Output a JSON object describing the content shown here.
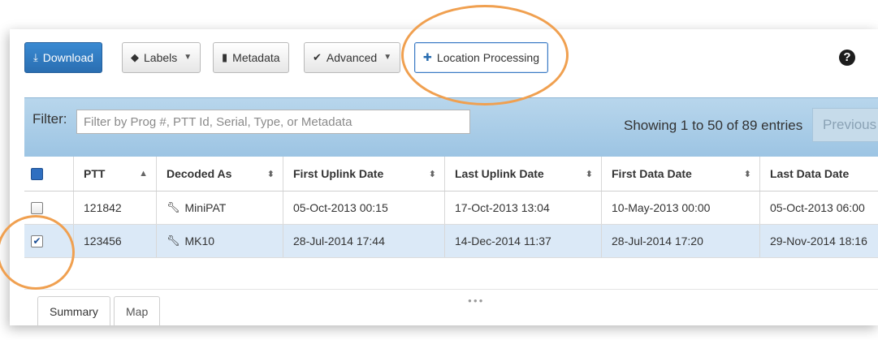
{
  "toolbar": {
    "download_label": "Download",
    "labels_label": "Labels",
    "metadata_label": "Metadata",
    "advanced_label": "Advanced",
    "location_processing_label": "Location Processing",
    "help_glyph": "?"
  },
  "filter": {
    "label": "Filter:",
    "placeholder": "Filter by Prog #, PTT Id, Serial, Type, or Metadata",
    "showing_text": "Showing 1 to 50 of 89 entries",
    "previous_label": "Previous"
  },
  "table": {
    "headers": [
      "PTT",
      "Decoded As",
      "First Uplink Date",
      "Last Uplink Date",
      "First Data Date",
      "Last Data Date"
    ],
    "rows": [
      {
        "checked": false,
        "ptt": "121842",
        "decoded_as": "MiniPAT",
        "first_uplink": "05-Oct-2013 00:15",
        "last_uplink": "17-Oct-2013 13:04",
        "first_data": "10-May-2013 00:00",
        "last_data": "05-Oct-2013 06:00"
      },
      {
        "checked": true,
        "ptt": "123456",
        "decoded_as": "MK10",
        "first_uplink": "28-Jul-2014 17:44",
        "last_uplink": "14-Dec-2014 11:37",
        "first_data": "28-Jul-2014 17:20",
        "last_data": "29-Nov-2014 18:16"
      }
    ]
  },
  "tabs": [
    "Summary",
    "Map"
  ],
  "icons": {
    "download": "download-icon",
    "labels": "tag-icon",
    "metadata": "book-icon",
    "advanced": "check-circle-icon",
    "location": "crosshair-icon",
    "help": "question-icon",
    "sort": "sort-icon",
    "wrench": "wrench-icon"
  },
  "colors": {
    "primary": "#2a6eb1",
    "annotation": "#f0a050",
    "filterbar": "#a9cce6",
    "selected_row": "#dbe9f7"
  }
}
